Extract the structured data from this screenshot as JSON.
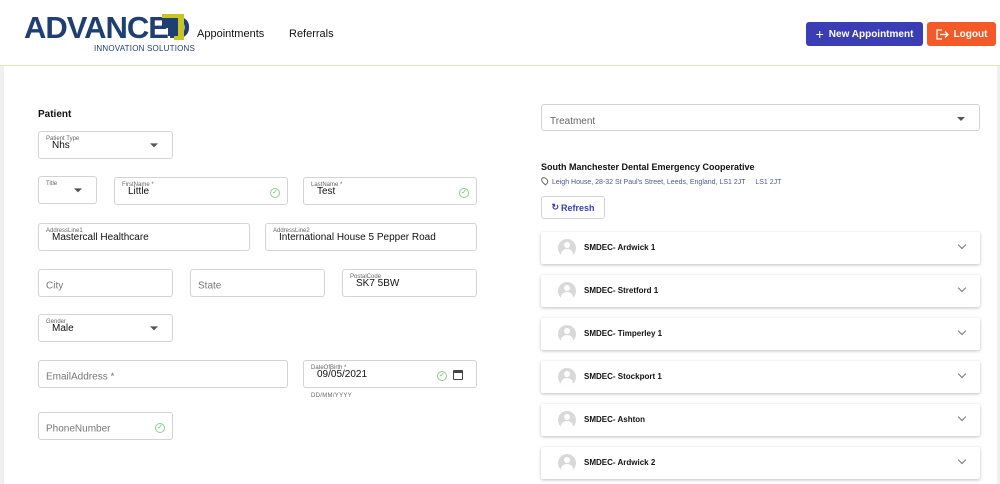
{
  "header": {
    "logo_text": "ADVANCED",
    "logo_subtitle": "INNOVATION SOLUTIONS",
    "nav": [
      "Appointments",
      "Referrals"
    ],
    "new_appointment_label": "New Appointment",
    "logout_label": "Logout",
    "colors": {
      "primary": "#3b3db4",
      "logout": "#f35a27",
      "logo": "#1f3f73"
    }
  },
  "patient": {
    "section_title": "Patient",
    "patient_type": {
      "label": "Patient Type",
      "value": "Nhs"
    },
    "title": {
      "label": "Title",
      "value": ""
    },
    "first_name": {
      "label": "FirstName *",
      "value": "Little"
    },
    "last_name": {
      "label": "LastName *",
      "value": "Test"
    },
    "address1": {
      "label": "AddressLine1",
      "value": "Mastercall Healthcare"
    },
    "address2": {
      "label": "AddressLine2",
      "value": "International House 5 Pepper Road"
    },
    "city": {
      "placeholder": "City"
    },
    "state": {
      "placeholder": "State"
    },
    "postal_code": {
      "label": "PostalCode",
      "value": "SK7 5BW"
    },
    "gender": {
      "label": "Gender",
      "value": "Male"
    },
    "email": {
      "placeholder": "EmailAddress *"
    },
    "dob": {
      "label": "DateOfBirth *",
      "value": "09/05/2021",
      "helper": "DD/MM/YYYY"
    },
    "phone": {
      "placeholder": "PhoneNumber"
    }
  },
  "clinic": {
    "treatment_placeholder": "Treatment",
    "name": "South Manchester Dental Emergency Cooperative",
    "address": "Leigh House, 28-32 St Paul's Street, Leeds, England, LS1 2JT",
    "postcode": "LS1 2JT",
    "refresh_label": "Refresh",
    "sites": [
      "SMDEC- Ardwick 1",
      "SMDEC- Stretford 1",
      "SMDEC- Timperley 1",
      "SMDEC- Stockport 1",
      "SMDEC- Ashton",
      "SMDEC- Ardwick 2"
    ]
  }
}
